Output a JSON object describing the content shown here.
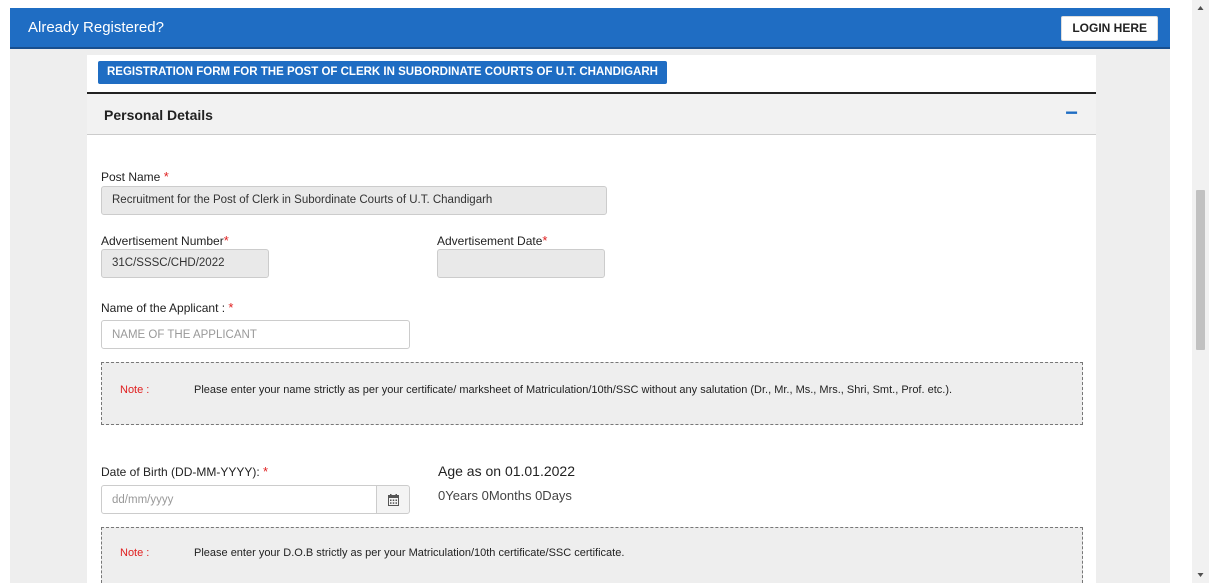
{
  "topbar": {
    "title": "Already Registered?",
    "login_label": "LOGIN HERE"
  },
  "form_title": "REGISTRATION FORM FOR THE POST OF CLERK IN SUBORDINATE COURTS OF U.T. CHANDIGARH",
  "section": {
    "title": "Personal Details",
    "toggle": "−"
  },
  "fields": {
    "post_name": {
      "label": "Post Name",
      "value": "Recruitment for the Post of Clerk in Subordinate Courts of U.T. Chandigarh"
    },
    "adv_number": {
      "label": "Advertisement Number",
      "value": "31C/SSSC/CHD/2022"
    },
    "adv_date": {
      "label": "Advertisement Date",
      "value": ""
    },
    "applicant_name": {
      "label": "Name of the Applicant :",
      "placeholder": "NAME OF THE APPLICANT"
    },
    "dob": {
      "label": "Date of Birth (DD-MM-YYYY):",
      "placeholder": "dd/mm/yyyy"
    }
  },
  "required_marker": "*",
  "notes": {
    "name": {
      "label": "Note :",
      "text": "Please enter your name strictly as per your certificate/ marksheet of Matriculation/10th/SSC without any salutation (Dr., Mr., Ms., Mrs., Shri, Smt., Prof. etc.)."
    },
    "dob": {
      "label": "Note :",
      "text": "Please enter your D.O.B strictly as per your Matriculation/10th certificate/SSC certificate."
    }
  },
  "age": {
    "title": "Age as on 01.01.2022",
    "value": "0Years 0Months 0Days"
  },
  "icons": {
    "calendar": "calendar-icon",
    "scroll_up": "arrow-up-icon",
    "scroll_down": "arrow-down-icon"
  },
  "colors": {
    "primary": "#1f6dc3",
    "required": "#e02020",
    "readonly_bg": "#e9e9e9"
  }
}
